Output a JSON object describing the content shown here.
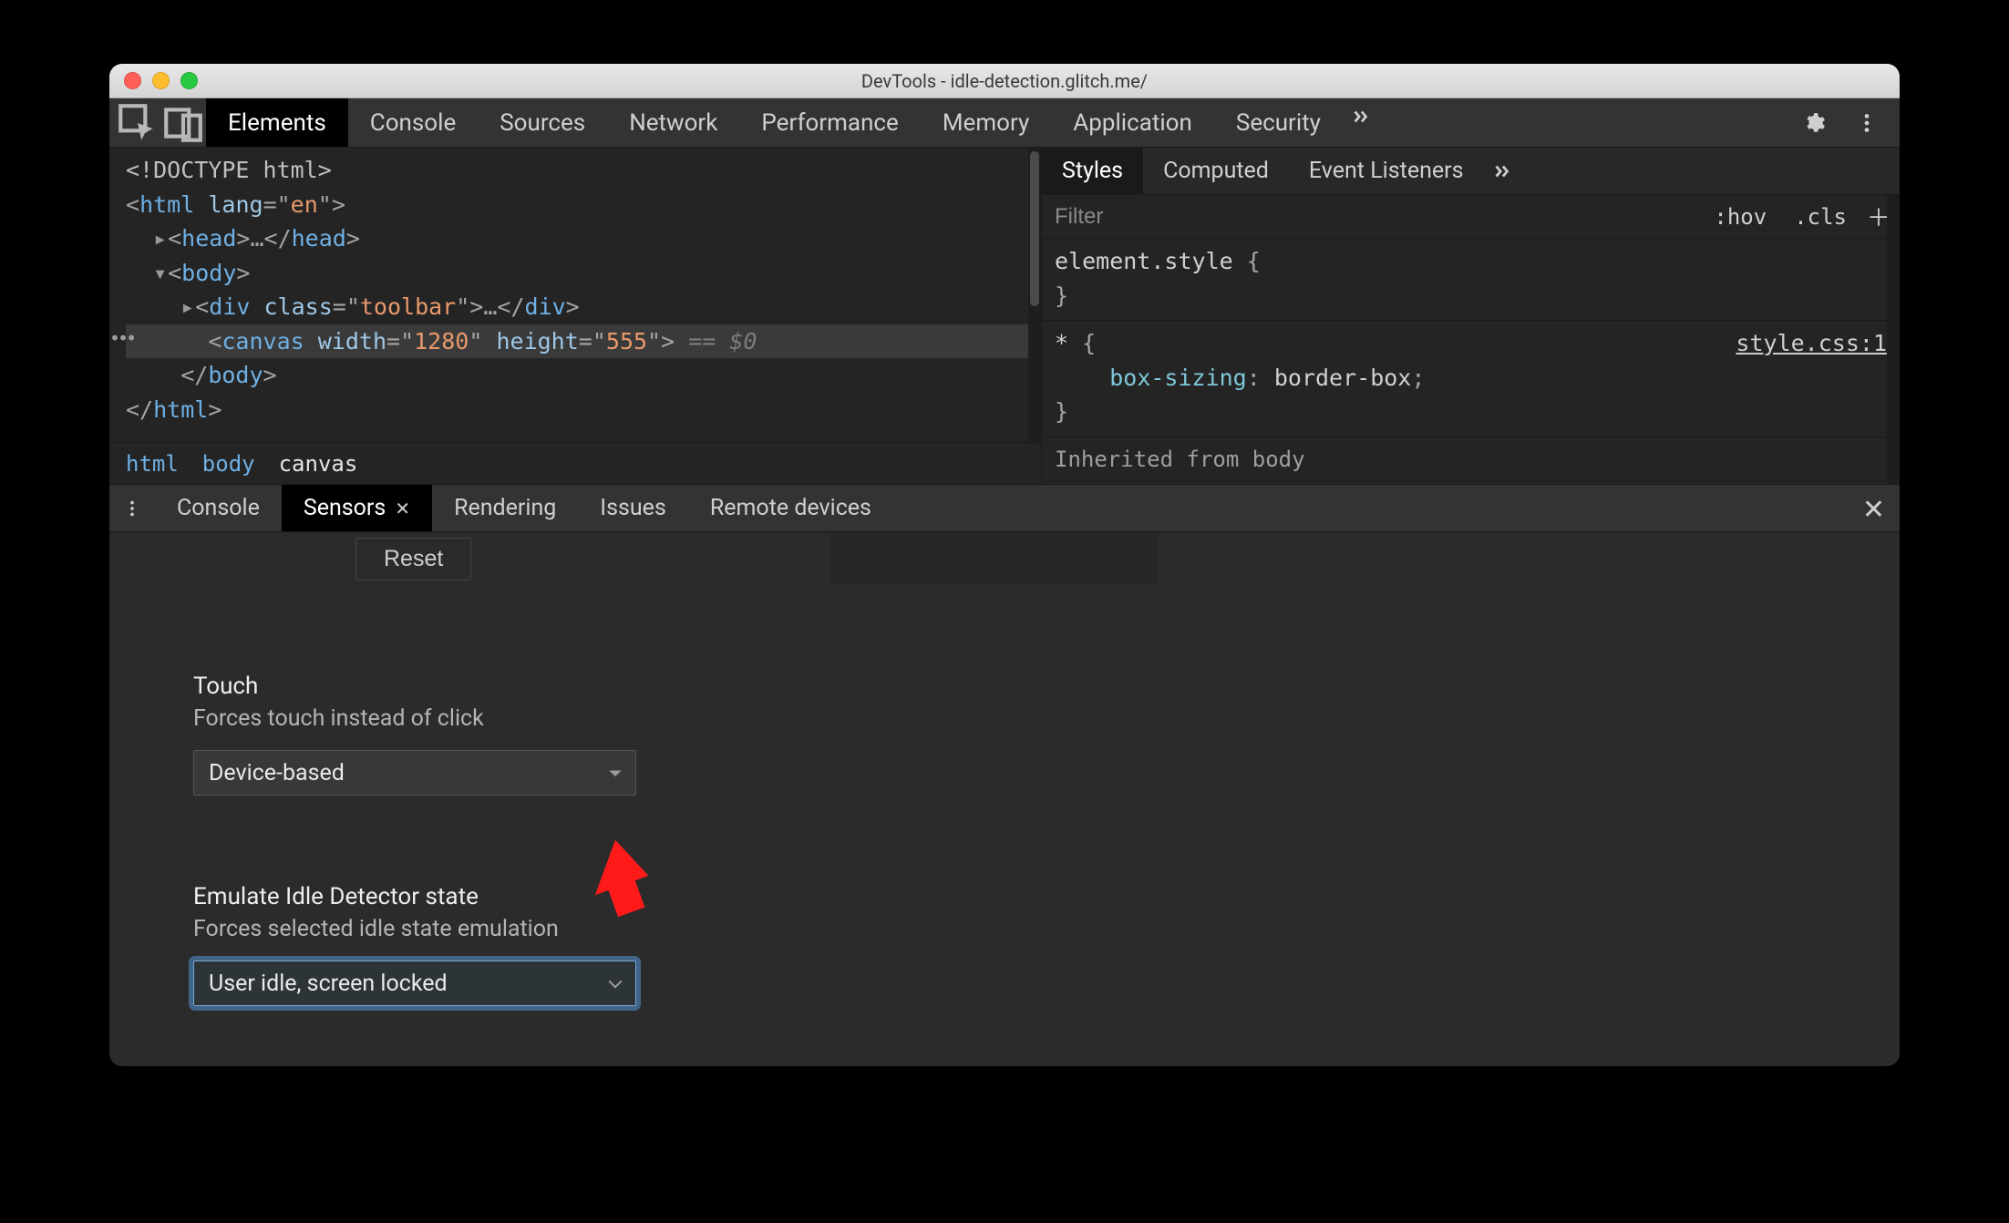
{
  "window": {
    "title": "DevTools - idle-detection.glitch.me/"
  },
  "tabbar": {
    "tabs": [
      "Elements",
      "Console",
      "Sources",
      "Network",
      "Performance",
      "Memory",
      "Application",
      "Security"
    ],
    "active": "Elements"
  },
  "elements": {
    "lines": {
      "l0_doctype": "<!DOCTYPE html>",
      "l1_tag": "html",
      "l1_attr": "lang",
      "l1_val": "en",
      "l2_tag": "head",
      "l2_ell": "…",
      "l3_tag": "body",
      "l4_tag": "div",
      "l4_attr": "class",
      "l4_val": "toolbar",
      "l4_ell": "…",
      "l5_tag": "canvas",
      "l5_a1": "width",
      "l5_v1": "1280",
      "l5_a2": "height",
      "l5_v2": "555",
      "l5_ghost": "== $0",
      "l6_close": "body",
      "l7_close": "html"
    },
    "breadcrumbs": [
      "html",
      "body",
      "canvas"
    ],
    "breadcrumb_active": "canvas"
  },
  "styles": {
    "tabs": [
      "Styles",
      "Computed",
      "Event Listeners"
    ],
    "active": "Styles",
    "filter_placeholder": "Filter",
    "toggles": {
      "hov": ":hov",
      "cls": ".cls"
    },
    "rules": {
      "r0": {
        "selector": "element.style",
        "body": []
      },
      "r1": {
        "selector": "*",
        "link": "style.css:1",
        "body_prop": "box-sizing",
        "body_val": "border-box"
      }
    },
    "inherit_label": "Inherited from",
    "inherit_src": "body"
  },
  "drawer": {
    "tabs": [
      "Console",
      "Sensors",
      "Rendering",
      "Issues",
      "Remote devices"
    ],
    "active": "Sensors",
    "reset_label": "Reset",
    "touch": {
      "title": "Touch",
      "sub": "Forces touch instead of click",
      "value": "Device-based"
    },
    "idle": {
      "title": "Emulate Idle Detector state",
      "sub": "Forces selected idle state emulation",
      "value": "User idle, screen locked"
    }
  },
  "annotation": {
    "arrow_color": "#ff1a1a"
  }
}
